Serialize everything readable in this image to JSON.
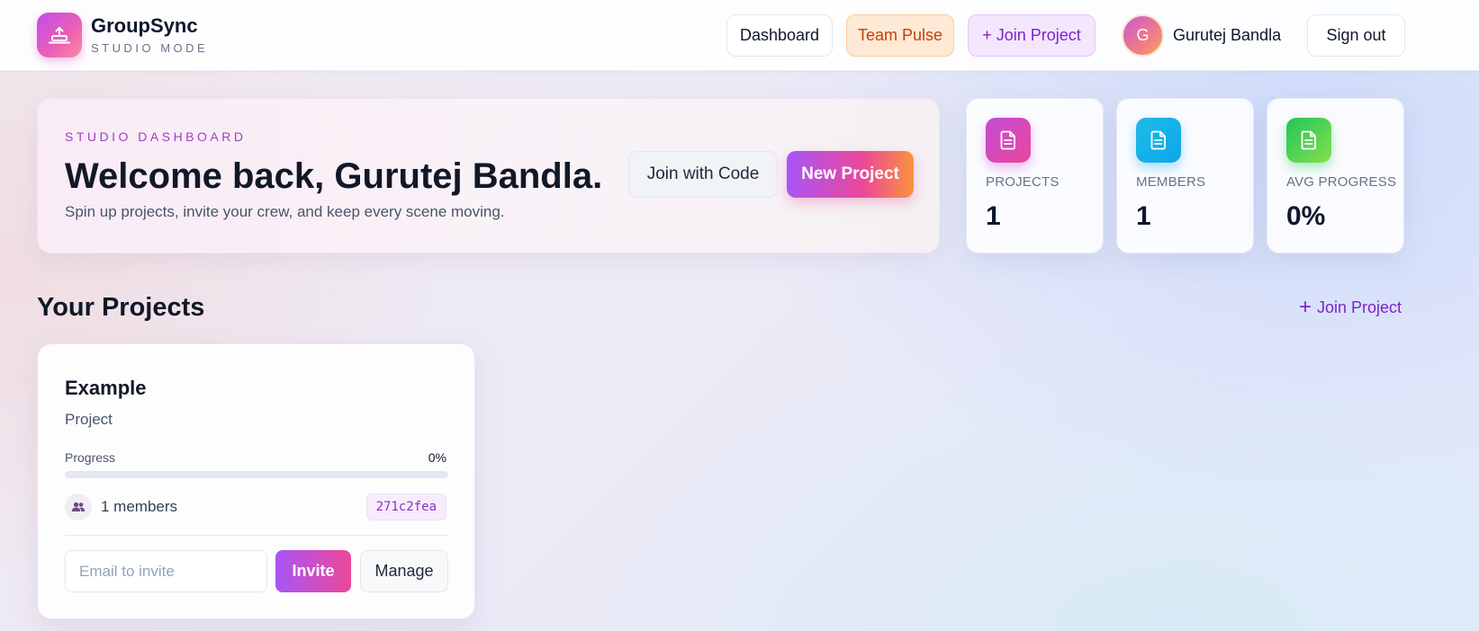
{
  "brand": {
    "name": "GroupSync",
    "subtitle": "STUDIO MODE",
    "logo_icon": "laptop-upload-icon"
  },
  "nav": {
    "dashboard": "Dashboard",
    "team_pulse": "Team Pulse",
    "join_project": "+ Join Project",
    "user": {
      "initial": "G",
      "name": "Gurutej Bandla"
    },
    "sign_out": "Sign out"
  },
  "welcome": {
    "eyebrow": "STUDIO DASHBOARD",
    "title": "Welcome back, Gurutej Bandla.",
    "subtitle": "Spin up projects, invite your crew, and keep every scene moving.",
    "join_code_label": "Join with Code",
    "new_project_label": "New Project"
  },
  "stats": [
    {
      "label": "PROJECTS",
      "value": "1",
      "icon": "document-icon",
      "color": "#d946ef"
    },
    {
      "label": "MEMBERS",
      "value": "1",
      "icon": "document-icon",
      "color": "#0ea5e9"
    },
    {
      "label": "AVG PROGRESS",
      "value": "0%",
      "icon": "document-icon",
      "color": "#22c55e"
    }
  ],
  "projects_section": {
    "title": "Your Projects",
    "join_link": "Join Project"
  },
  "projects": [
    {
      "name": "Example",
      "type": "Project",
      "progress_label": "Progress",
      "progress_value": "0%",
      "progress_fraction": 0,
      "members_text": "1 members",
      "code": "271c2fea",
      "invite_placeholder": "Email to invite",
      "invite_label": "Invite",
      "manage_label": "Manage"
    }
  ],
  "colors": {
    "accent": "#a855f7",
    "accent_pink": "#ec4899",
    "accent_orange": "#fb923c",
    "link": "#7e22ce"
  }
}
